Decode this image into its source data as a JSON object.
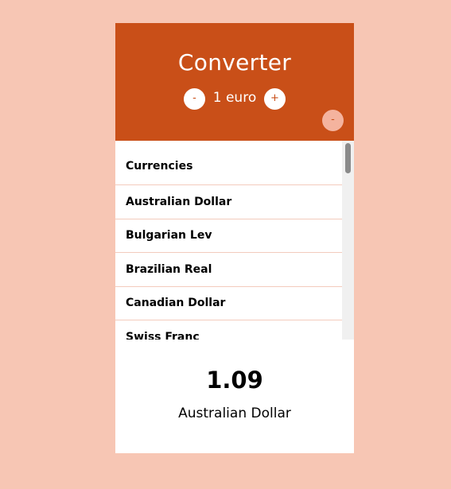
{
  "header": {
    "title": "Converter",
    "decrease_label": "-",
    "amount_label": "1 euro",
    "increase_label": "+",
    "remove_label": "-"
  },
  "currency_list": {
    "heading": "Currencies",
    "items": [
      "Australian Dollar",
      "Bulgarian Lev",
      "Brazilian Real",
      "Canadian Dollar",
      "Swiss Franc"
    ]
  },
  "result": {
    "value": "1.09",
    "currency": "Australian Dollar"
  },
  "colors": {
    "background": "#f7c6b4",
    "header": "#c94f18",
    "card": "#ffffff",
    "divider": "#f3cbbd"
  }
}
